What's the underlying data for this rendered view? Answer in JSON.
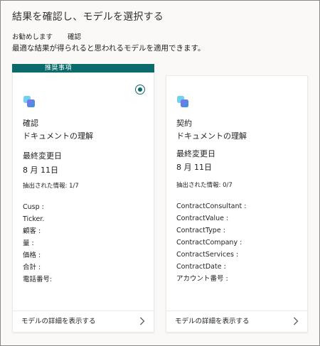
{
  "header": {
    "title": "結果を確認し、モデルを選択する",
    "recommended_label": "お勧めします",
    "recommended_model": "確認",
    "description": "最適な結果が得られると思われるモデルを適用できます。"
  },
  "colors": {
    "accent": "#0b6a6b",
    "border": "#8a8886",
    "card_divider": "#edebe9"
  },
  "cards": [
    {
      "badge": "推奨事項",
      "selected": true,
      "icon": "model-cube-icon",
      "name": "確認",
      "type": "ドキュメントの理解",
      "modified_label": "最終変更日",
      "modified_date": "8 月 11日",
      "extracted": "抽出された情報: 1/7",
      "fields": [
        "Cusp :",
        "Ticker.",
        "顧客 :",
        "量 :",
        "価格 :",
        "合計 :",
        "電話番号:"
      ],
      "footer_label": "モデルの詳細を表示する",
      "footer_icon": "chevron-right-icon"
    },
    {
      "selected": false,
      "icon": "model-cube-icon",
      "name": "契約",
      "type": "ドキュメントの理解",
      "modified_label": "最終変更日",
      "modified_date": "8 月 11日",
      "extracted": "抽出された情報: 0/7",
      "fields": [
        "ContractConsultant :",
        "ContractValue :",
        "ContractType :",
        "ContractCompany :",
        "ContractServices :",
        "ContractDate :",
        "アカウント番号 :"
      ],
      "footer_label": "モデルの詳細を表示する",
      "footer_icon": "chevron-right-icon"
    }
  ]
}
